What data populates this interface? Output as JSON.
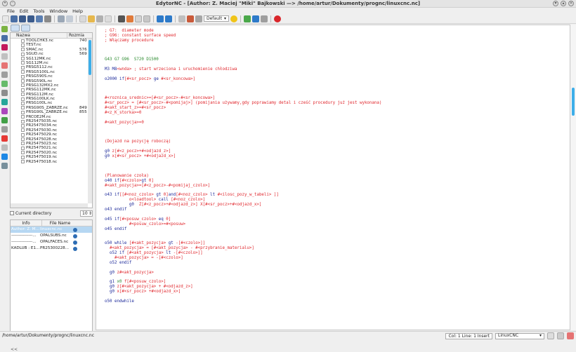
{
  "window": {
    "title": "EdytorNC - [Author: Z. Maciej \"Miki\" Bajkowski —> /home/artur/Dokumenty/prognc/linuxcnc.nc]"
  },
  "menu": [
    "File",
    "Edit",
    "Tools",
    "Window",
    "Help"
  ],
  "toolbar": {
    "font_combo": "Default"
  },
  "filebrowser": {
    "col_name": "Nazwa",
    "col_size": "Rozmia",
    "files": [
      {
        "name": "TOOLCHK3.nc",
        "size": "740 b"
      },
      {
        "name": "TEST.nc",
        "size": ""
      },
      {
        "name": "SMAC.nc",
        "size": "576 b"
      },
      {
        "name": "SGUD.nc",
        "size": "569 b"
      },
      {
        "name": "SG112MK.nc",
        "size": ""
      },
      {
        "name": "SG112M.nc",
        "size": ""
      },
      {
        "name": "PRSG5112.nc",
        "size": ""
      },
      {
        "name": "PRSG5100L.nc",
        "size": ""
      },
      {
        "name": "PRSG590S.nc",
        "size": ""
      },
      {
        "name": "PRSG590L.nc",
        "size": ""
      },
      {
        "name": "PRSG132MX2.nc",
        "size": ""
      },
      {
        "name": "PRSG112MK.nc",
        "size": ""
      },
      {
        "name": "PRSG112M.nc",
        "size": ""
      },
      {
        "name": "PRSG100LK.nc",
        "size": ""
      },
      {
        "name": "PRSG100L.nc",
        "size": ""
      },
      {
        "name": "PRSG90S_ZABRZE.nc",
        "size": "849 b"
      },
      {
        "name": "PRSG90L_ZABRZE.nc",
        "size": "855 b"
      },
      {
        "name": "PRCOE2M.nc",
        "size": ""
      },
      {
        "name": "PR25475035.nc",
        "size": ""
      },
      {
        "name": "PR25475034.nc",
        "size": ""
      },
      {
        "name": "PR25475030.nc",
        "size": ""
      },
      {
        "name": "PR25475029.nc",
        "size": ""
      },
      {
        "name": "PR25475028.nc",
        "size": ""
      },
      {
        "name": "PR25475023.nc",
        "size": ""
      },
      {
        "name": "PR25475021.nc",
        "size": ""
      },
      {
        "name": "PR25475020.nc",
        "size": ""
      },
      {
        "name": "PR25475019.nc",
        "size": ""
      },
      {
        "name": "PR25475018.nc",
        "size": ""
      }
    ],
    "current_dir_label": "Current directory",
    "spin_value": "10"
  },
  "history": {
    "col_info": "Info",
    "col_file": "File Name",
    "rows": [
      {
        "info": "Author: Z. M...",
        "file": "linuxcnc.nc"
      },
      {
        "info": "---------------...",
        "file": "OPALSUBS.nc"
      },
      {
        "info": "---------------...",
        "file": "OPALFACES.nc"
      },
      {
        "info": "KADLUB : E1...",
        "file": "PR25300228..."
      }
    ]
  },
  "left_bottom": "<<",
  "code_lines": [
    [
      {
        "t": "; G7:  diameter mode",
        "c": "red"
      }
    ],
    [
      {
        "t": "; G96: constant surface speed",
        "c": "red"
      }
    ],
    [
      {
        "t": "; Włączamy procedure",
        "c": "red"
      }
    ],
    [],
    [],
    [],
    [
      {
        "t": "G43 G7 G96  S720 D1500",
        "c": "grn"
      }
    ],
    [],
    [
      {
        "t": "M3 M8",
        "c": "blu"
      },
      {
        "t": "<wnda>",
        "c": "red"
      },
      {
        "t": " ; start wrzeciona i uruchomienie chłodziwa",
        "c": "red"
      }
    ],
    [],
    [
      {
        "t": "o2000 ",
        "c": "blu"
      },
      {
        "t": "if",
        "c": "blu"
      },
      {
        "t": "[#<sr_pocz> ",
        "c": "red"
      },
      {
        "t": "ge",
        "c": "blu"
      },
      {
        "t": " #<sr_koncowa>]",
        "c": "red"
      }
    ],
    [],
    [],
    [],
    [
      {
        "t": "#<roznica_srednic>=[#<sr_pocz>-#<sr_koncowa>]",
        "c": "red"
      }
    ],
    [
      {
        "t": "#<sr_pocz> = [#<sr_pocz>-#<pomijaj>] (pomijania używamy,gdy poprawiamy detal i cześć procedury już jest wykonana)",
        "c": "red"
      }
    ],
    [
      {
        "t": "#<akt_start_z>=#<sr_pocz>",
        "c": "red"
      }
    ],
    [
      {
        "t": "#<z_K_storka>=0",
        "c": "red"
      }
    ],
    [],
    [
      {
        "t": "#<akt_pozycja>=0",
        "c": "red"
      }
    ],
    [],
    [],
    [],
    [
      {
        "t": "(Dojazd na pozycję roboczą)",
        "c": "red"
      }
    ],
    [],
    [
      {
        "t": "g0 ",
        "c": "blu"
      },
      {
        "t": "z[#<z_pocz>+#<odjazd_z>]",
        "c": "red"
      }
    ],
    [
      {
        "t": "g0 ",
        "c": "blu"
      },
      {
        "t": "x[#<sr_pocz> +#<odjazd_x>]",
        "c": "red"
      }
    ],
    [],
    [],
    [],
    [
      {
        "t": "(Planowanie czoła)",
        "c": "red"
      }
    ],
    [
      {
        "t": "o40 ",
        "c": "blu"
      },
      {
        "t": "if",
        "c": "blu"
      },
      {
        "t": "[#<czolo>",
        "c": "red"
      },
      {
        "t": "gt",
        "c": "blu"
      },
      {
        "t": " 0]",
        "c": "red"
      }
    ],
    [
      {
        "t": "#<akt_pozycja>=[#<z_pocz>-#<pomijaj_czolo>]",
        "c": "red"
      }
    ],
    [],
    [
      {
        "t": "o43 ",
        "c": "blu"
      },
      {
        "t": "if",
        "c": "blu"
      },
      {
        "t": "[[#<noz_czolo> ",
        "c": "red"
      },
      {
        "t": "gt",
        "c": "blu"
      },
      {
        "t": " 0]",
        "c": "red"
      },
      {
        "t": "and",
        "c": "blu"
      },
      {
        "t": "[#<noz_czolo> ",
        "c": "red"
      },
      {
        "t": "lt",
        "c": "blu"
      },
      {
        "t": " #<ilosc_pozy_w_tabeli> ]]",
        "c": "red"
      }
    ],
    [
      {
        "t": "          o<loadtool> ",
        "c": "red"
      },
      {
        "t": "call",
        "c": "blu"
      },
      {
        "t": " [#<noz_czolo>]",
        "c": "red"
      }
    ],
    [
      {
        "t": "          g0  ",
        "c": "blu"
      },
      {
        "t": "Z[#<z_pocz>+#<odjazd_z>] X[#<sr_pocz>+#<odjazd_x>]",
        "c": "red"
      }
    ],
    [
      {
        "t": "o43 ",
        "c": "blu"
      },
      {
        "t": "endif",
        "c": "blu"
      }
    ],
    [],
    [
      {
        "t": "o45 ",
        "c": "blu"
      },
      {
        "t": "if",
        "c": "blu"
      },
      {
        "t": "[#<posuw_czolo> ",
        "c": "red"
      },
      {
        "t": "eq",
        "c": "blu"
      },
      {
        "t": " 0]",
        "c": "red"
      }
    ],
    [
      {
        "t": "          #<posuw_czolo>=#<posuw>",
        "c": "red"
      }
    ],
    [
      {
        "t": "o45 ",
        "c": "blu"
      },
      {
        "t": "endif",
        "c": "blu"
      }
    ],
    [],
    [],
    [
      {
        "t": "o50 ",
        "c": "blu"
      },
      {
        "t": "while",
        "c": "blu"
      },
      {
        "t": " [#<akt_pozycja> ",
        "c": "red"
      },
      {
        "t": "gt",
        "c": "blu"
      },
      {
        "t": " -[#<czolo>]]",
        "c": "red"
      }
    ],
    [
      {
        "t": "  #<akt_pozycja> = [#<akt_pozycja> - #<przybranie_materialu>]",
        "c": "red"
      }
    ],
    [
      {
        "t": "  o52 ",
        "c": "blu"
      },
      {
        "t": "if",
        "c": "blu"
      },
      {
        "t": " [#<akt_pozycja> ",
        "c": "red"
      },
      {
        "t": "lt",
        "c": "blu"
      },
      {
        "t": " -[#<czolo>]]",
        "c": "red"
      }
    ],
    [
      {
        "t": "    #<akt_pozycja> = -[#<czolo>]",
        "c": "red"
      }
    ],
    [
      {
        "t": "  o52 ",
        "c": "blu"
      },
      {
        "t": "endif",
        "c": "blu"
      }
    ],
    [],
    [
      {
        "t": "  g0 ",
        "c": "blu"
      },
      {
        "t": "z#<akt_pozycja>",
        "c": "red"
      }
    ],
    [],
    [
      {
        "t": "  g1 ",
        "c": "blu"
      },
      {
        "t": "x0 ",
        "c": "grn"
      },
      {
        "t": "f[#<posuw_czolo>]",
        "c": "red"
      }
    ],
    [
      {
        "t": "  g0 ",
        "c": "blu"
      },
      {
        "t": "z[#<akt_pozycja> + #<odjazd_z>]",
        "c": "red"
      }
    ],
    [
      {
        "t": "  g0 ",
        "c": "blu"
      },
      {
        "t": "x[#<sr_pocz> +#<odjazd_x>]",
        "c": "red"
      }
    ],
    [],
    [
      {
        "t": "o50 ",
        "c": "blu"
      },
      {
        "t": "endwhile",
        "c": "blu"
      }
    ]
  ],
  "status": {
    "path": "/home/artur/Dokumenty/prognc/linuxcnc.nc",
    "position": "Col: 1  Line: 1  Insert",
    "highlight": "LinuxCNC"
  },
  "colors": {
    "red": "#e0262c",
    "green": "#2b8a2e",
    "blue": "#1d2a9a",
    "accent": "#3daee9"
  }
}
